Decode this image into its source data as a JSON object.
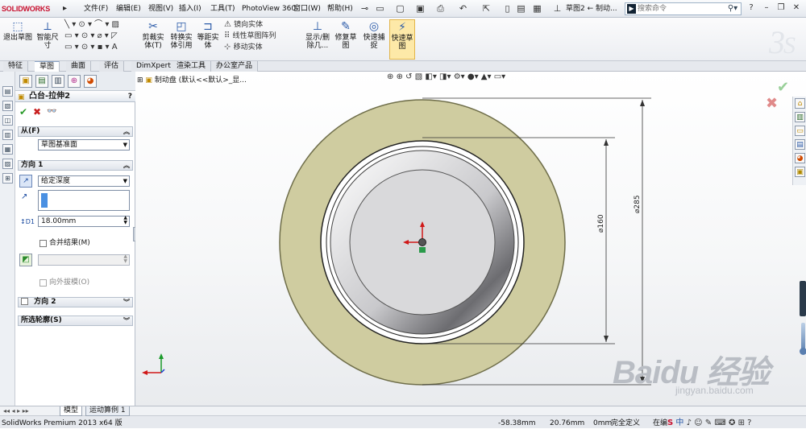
{
  "app": {
    "logo": "SOLIDWORKS",
    "menus": [
      "文件(F)",
      "编辑(E)",
      "视图(V)",
      "插入(I)",
      "工具(T)",
      "PhotoView 360",
      "窗口(W)",
      "帮助(H)"
    ],
    "doc_title": "草图2 ← 制动...",
    "search_placeholder": "搜索命令"
  },
  "command_manager": {
    "exit_sketch": "退出草图",
    "smart_dim": "智能尺寸",
    "trim": "剪裁实体(T)",
    "convert": "转换实体引用",
    "offset": "等距实体",
    "mirror": "镜向实体",
    "linear_pattern": "线性草图阵列",
    "move": "移动实体",
    "display_delete": "显示/删除几...",
    "repair": "修复草图",
    "snap": "快速捕捉",
    "rapid_sketch": "快速草图"
  },
  "tabs": [
    "特征",
    "草图",
    "曲面",
    "评估",
    "DimXpert",
    "渲染工具",
    "办公室产品"
  ],
  "active_tab": "草图",
  "property_manager": {
    "title": "凸台-拉伸2",
    "help": "?",
    "from_label": "从(F)",
    "from_value": "草图基准面",
    "dir1_label": "方向 1",
    "dir1_type": "给定深度",
    "depth": "18.00mm",
    "merge_label": "合并结果(M)",
    "draft_label": "向外拔模(O)",
    "dir2_label": "方向 2",
    "contours_label": "所选轮廓(S)"
  },
  "viewport": {
    "tree_label": "制动盘 (默认<<默认>_显..."
  },
  "dimensions": {
    "inner": "⌀160",
    "outer": "⌀285"
  },
  "bottom_tabs": [
    "模型",
    "运动算例 1"
  ],
  "status": {
    "product": "SolidWorks Premium 2013 x64 版",
    "x": "-58.38mm",
    "y": "20.76mm",
    "z": "0mm",
    "state": "完全定义",
    "edit": "在编"
  },
  "watermark": {
    "brand": "Baidu 经验",
    "url": "jingyan.baidu.com"
  },
  "colors": {
    "ring_outer": "#cfcca0",
    "ring_edge": "#7a7a50",
    "accent": "#c8102e"
  }
}
